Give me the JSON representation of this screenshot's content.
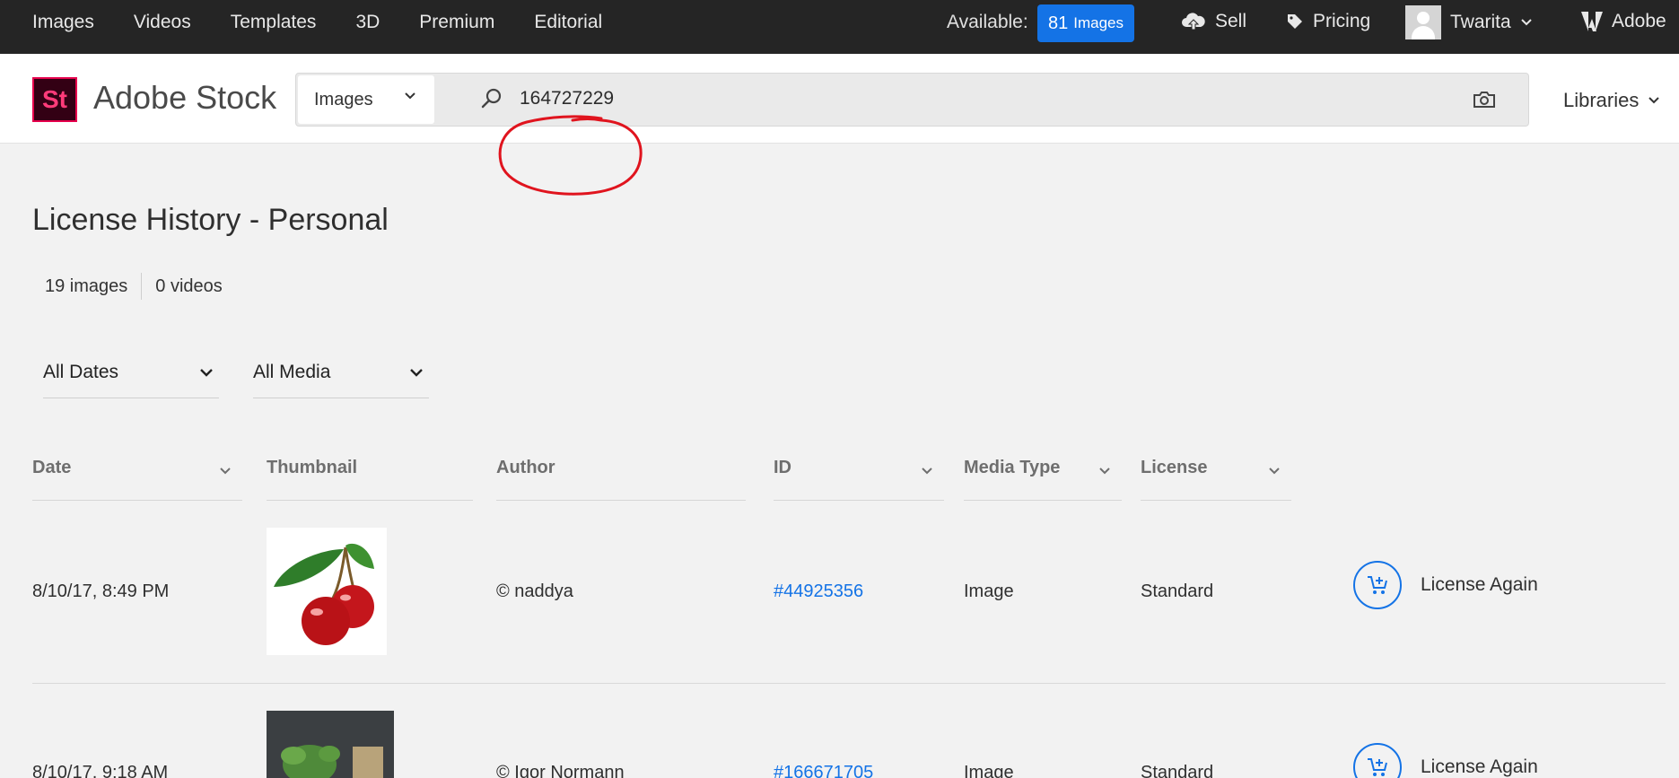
{
  "topbar": {
    "nav": [
      "Images",
      "Videos",
      "Templates",
      "3D",
      "Premium",
      "Editorial"
    ],
    "available_label": "Available:",
    "available_count": "81",
    "available_unit": "Images",
    "sell": "Sell",
    "pricing": "Pricing",
    "user": "Twarita",
    "adobe": "Adobe"
  },
  "header": {
    "logo_text": "St",
    "brand": "Adobe Stock",
    "search_type": "Images",
    "search_value": "164727229",
    "libraries": "Libraries"
  },
  "main": {
    "title": "License History - Personal",
    "images_count": "19 images",
    "videos_count": "0 videos",
    "filters": {
      "dates": "All Dates",
      "media": "All Media"
    },
    "columns": [
      "Date",
      "Thumbnail",
      "Author",
      "ID",
      "Media Type",
      "License"
    ],
    "rows": [
      {
        "date": "8/10/17, 8:49 PM",
        "author": "© naddya",
        "id": "#44925356",
        "media_type": "Image",
        "license": "Standard",
        "action": "License Again"
      },
      {
        "date": "8/10/17, 9:18 AM",
        "author": "© Igor Normann",
        "id": "#166671705",
        "media_type": "Image",
        "license": "Standard",
        "action": "License Again"
      }
    ]
  },
  "colors": {
    "accent": "#1473e6",
    "topbar": "#252525",
    "annotation": "#e0141e"
  },
  "icons": [
    "upload-cloud-icon",
    "tag-icon",
    "chevron-down-icon",
    "search-icon",
    "camera-icon",
    "cart-add-icon",
    "adobe-logo-icon"
  ]
}
